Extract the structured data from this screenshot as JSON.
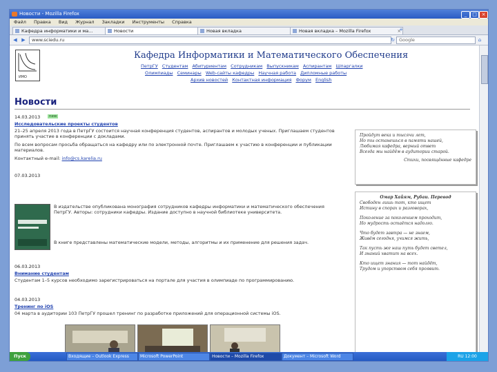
{
  "window": {
    "title": "Новости - Mozilla Firefox"
  },
  "menu": [
    "Файл",
    "Правка",
    "Вид",
    "Журнал",
    "Закладки",
    "Инструменты",
    "Справка"
  ],
  "tabs": [
    {
      "label": "Кафедра информатики и ма...",
      "active": false
    },
    {
      "label": "Новости",
      "active": true
    },
    {
      "label": "Новая вкладка",
      "active": false
    },
    {
      "label": "Новая вкладка – Mozilla Firefox",
      "active": false
    }
  ],
  "nav": {
    "url": "www.sciedu.ru",
    "search_placeholder": "Google"
  },
  "site": {
    "title": "Кафедра Информатики и Математического Обеспечения",
    "nav_row1": [
      "ПетрГУ",
      "Студентам",
      "Абитуриентам",
      "Сотрудникам",
      "Выпускникам",
      "Аспирантам",
      "Шпаргалки"
    ],
    "nav_row2": [
      "Олимпиады",
      "Семинары",
      "Web-сайты кафедры",
      "Научная работа",
      "Дипломные работы"
    ],
    "nav_row3": [
      "Архив новостей",
      "Контактная информация",
      "Форум",
      "English"
    ]
  },
  "news_heading": "Новости",
  "news": [
    {
      "date": "14.03.2013",
      "badge": "new",
      "headline": "Исследовательские проекты студентов",
      "text1": "21–25 апреля 2013 года в ПетрГУ состоится научная конференция студентов, аспирантов и молодых ученых. Приглашаем студентов принять участие в конференции с докладами.",
      "text2": "По всем вопросам просьба обращаться на кафедру или по электронной почте. Приглашаем к участию в конференции и публикации материалов.",
      "text3": "Контактный e-mail:",
      "link": "info@cs.karelia.ru"
    },
    {
      "date": "07.03.2013",
      "text1": "В издательстве опубликована монография сотрудников кафедры информатики и математического обеспечения ПетрГУ. Авторы: сотрудники кафедры. Издание доступно в научной библиотеке университета.",
      "text2": "В книге представлены математические модели, методы, алгоритмы и их применение для решения задач."
    },
    {
      "date": "06.03.2013",
      "headline": "Внимание студентам",
      "text1": "Студентам 1–5 курсов необходимо зарегистрироваться на портале для участия в олимпиаде по программированию."
    },
    {
      "date": "04.03.2013",
      "headline": "Тренинг по iOS",
      "text1": "04 марта в аудитории 103 ПетрГУ прошел тренинг по разработке приложений для операционной системы iOS."
    }
  ],
  "poem1": [
    "Пройдут века и тысячи лет,",
    "Но ты останешься в памяти нашей,",
    "Любимая кафедра, верный ответ",
    "Всегда мы найдём в аудитории старой.",
    "",
    "Стихи, посвящённые кафедре"
  ],
  "poem2_title": "Омар Хайям, Рубаи. Перевод",
  "poem2": [
    "Свободен лишь тот, кто ищет",
    "Истину в спорах и разговорах,",
    "",
    "Поколение за поколением проходит,",
    "Но мудрость остаётся надолго.",
    "",
    "Что будет завтра — не знаем,",
    "Живём сегодня, учимся жить,",
    "",
    "Так пусть же наш путь будет светел,",
    "И знаний хватит на всех.",
    "",
    "Кто ищет знания — тот найдёт,",
    "Трудом и упорством себя проявит."
  ],
  "taskbar": {
    "start": "Пуск",
    "buttons": [
      {
        "label": "Входящие – Outlook Express",
        "active": false
      },
      {
        "label": "Microsoft PowerPoint",
        "active": false
      },
      {
        "label": "Новости – Mozilla Firefox",
        "active": true
      },
      {
        "label": "Документ – Microsoft Word",
        "active": false
      }
    ],
    "clock": "RU 12:00"
  }
}
